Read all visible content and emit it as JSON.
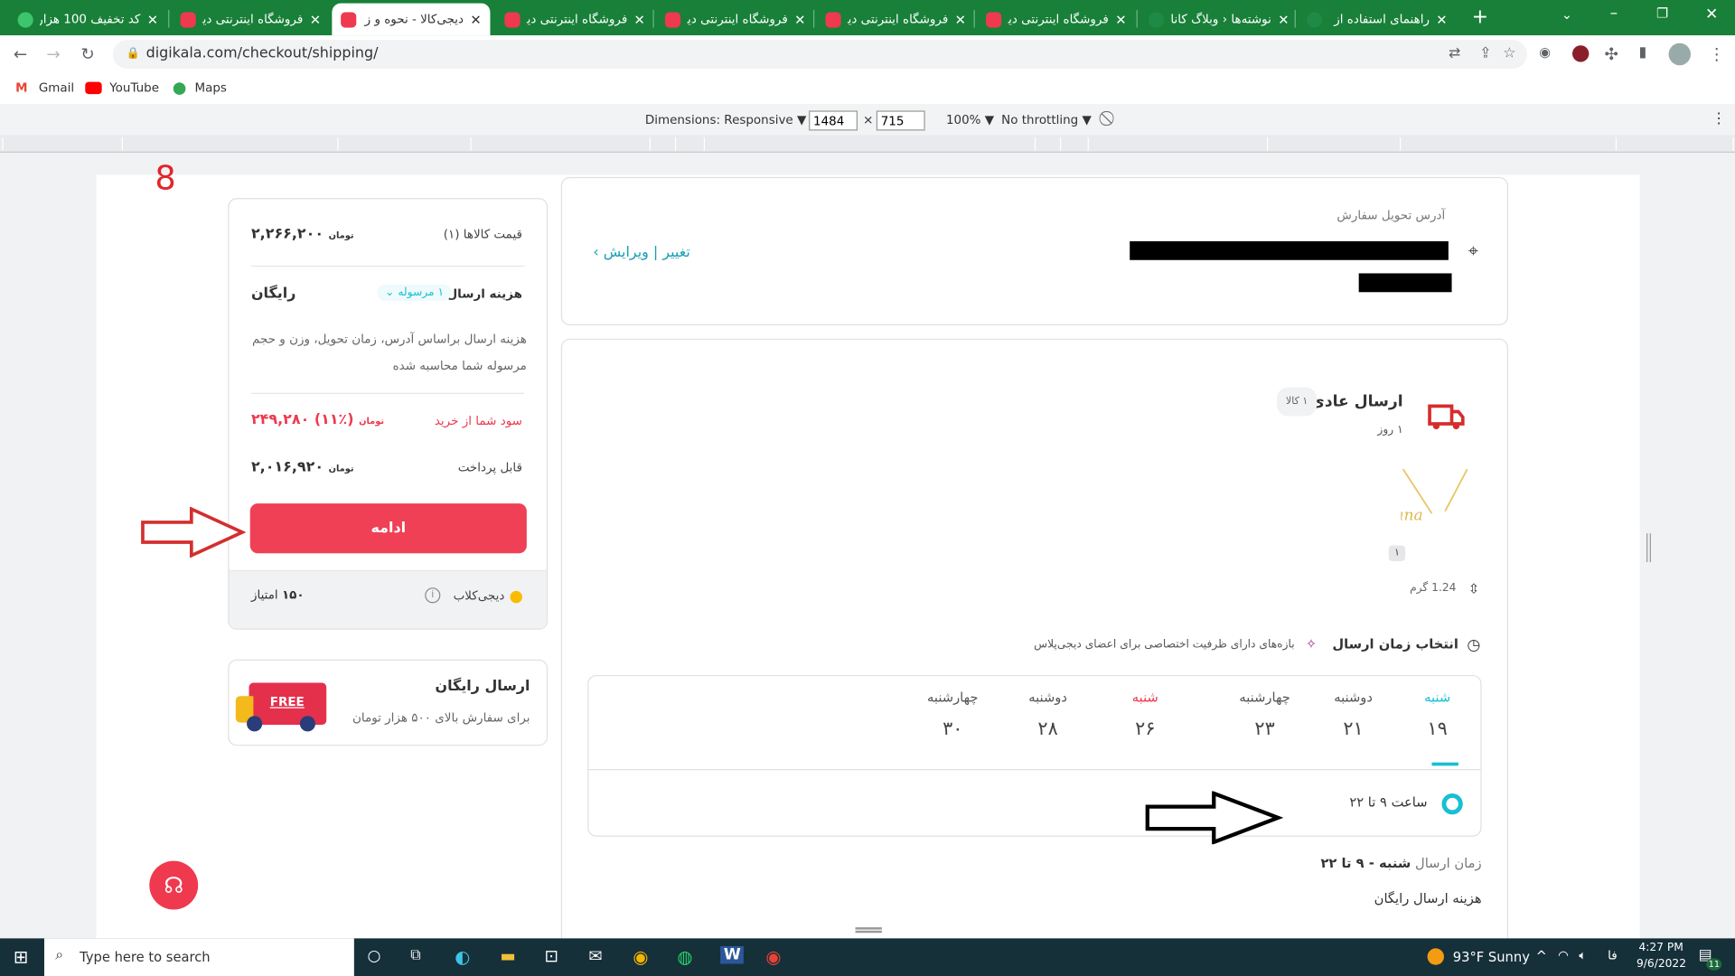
{
  "browser": {
    "tabs": [
      {
        "title": "کد تخفیف 100 هزار",
        "icon": "percent-badge-icon"
      },
      {
        "title": "فروشگاه اینترنتی دیـ",
        "icon": "digikala-icon"
      },
      {
        "title": "دیجی‌کالا - نحوه و ز",
        "icon": "digikala-icon",
        "active": true
      },
      {
        "title": "فروشگاه اینترنتی دیـ",
        "icon": "digikala-icon"
      },
      {
        "title": "فروشگاه اینترنتی دیـ",
        "icon": "digikala-icon"
      },
      {
        "title": "فروشگاه اینترنتی دیـ",
        "icon": "digikala-icon"
      },
      {
        "title": "فروشگاه اینترنتی دیـ",
        "icon": "digikala-icon"
      },
      {
        "title": "نوشته‌ها ‹ وبلاگ کانا",
        "icon": "globe-icon"
      },
      {
        "title": "راهنمای استفاده از",
        "icon": "globe-icon"
      }
    ],
    "close_glyph": "✕",
    "url": "digikala.com/checkout/shipping/",
    "bookmarks": [
      "Gmail",
      "YouTube",
      "Maps"
    ]
  },
  "devtools": {
    "dimensions": "Dimensions: Responsive ▼",
    "width": "1484",
    "times": "×",
    "height": "715",
    "zoom": "100% ▼",
    "throttling": "No throttling ▼"
  },
  "annotations": {
    "number": "8",
    "arrow_color": "#d32f2f"
  },
  "summary": {
    "items_label": "قیمت کالاها (۱)",
    "items_price": "۲,۲۶۶,۲۰۰",
    "currency": "تومان",
    "shipping_label": "هزینه ارسال",
    "shipment_badge": "۱ مرسوله",
    "shipping_value": "رایگان",
    "shipping_note": "هزینه ارسال براساس آدرس، زمان تحویل، وزن و حجم مرسوله شما محاسبه شده",
    "profit_label": "سود شما از خرید",
    "profit_value": "۲۴۹,۲۸۰ (۱۱٪)",
    "payable_label": "قابل پرداخت",
    "payable_value": "۲,۰۱۶,۹۲۰",
    "continue_button": "ادامه",
    "club_label": "دیجی‌کلاب",
    "points_value": "۱۵۰",
    "points_label": "امتیاز"
  },
  "free_shipping": {
    "title": "ارسال رایگان",
    "subtitle": "برای سفارش بالای ۵۰۰ هزار تومان",
    "badge": "FREE"
  },
  "address": {
    "title": "آدرس تحویل سفارش",
    "edit_link": "تغییر | ویرایش"
  },
  "shipment": {
    "title": "ارسال عادی",
    "count_badge": "۱ کالا",
    "duration": "۱ روز",
    "product_qty": "۱",
    "weight": "1.24 گرم",
    "time_title": "انتخاب زمان ارسال",
    "plus_note": "بازه‌های دارای ظرفیت اختصاصی برای اعضای دیجی‌پلاس",
    "days": [
      {
        "name": "شنبه",
        "num": "۱۹",
        "selected": true
      },
      {
        "name": "دوشنبه",
        "num": "۲۱"
      },
      {
        "name": "چهارشنبه",
        "num": "۲۳"
      },
      {
        "name": "شنبه",
        "num": "۲۶",
        "holiday": true
      },
      {
        "name": "دوشنبه",
        "num": "۲۸"
      },
      {
        "name": "چهارشنبه",
        "num": "۳۰"
      }
    ],
    "slot": "ساعت ۹ تا ۲۲",
    "send_time_label": "زمان ارسال",
    "send_time_value": "شنبه - ۹ تا ۲۲",
    "cost_label": "هزینه ارسال",
    "cost_value": "رایگان"
  },
  "colors": {
    "brand": "#ef394e",
    "teal": "#19bfd3",
    "tab_green": "#188038"
  },
  "taskbar": {
    "search_placeholder": "Type here to search",
    "weather": "93°F  Sunny",
    "lang": "فا",
    "time": "4:27 PM",
    "date": "9/6/2022",
    "notif": "11"
  }
}
